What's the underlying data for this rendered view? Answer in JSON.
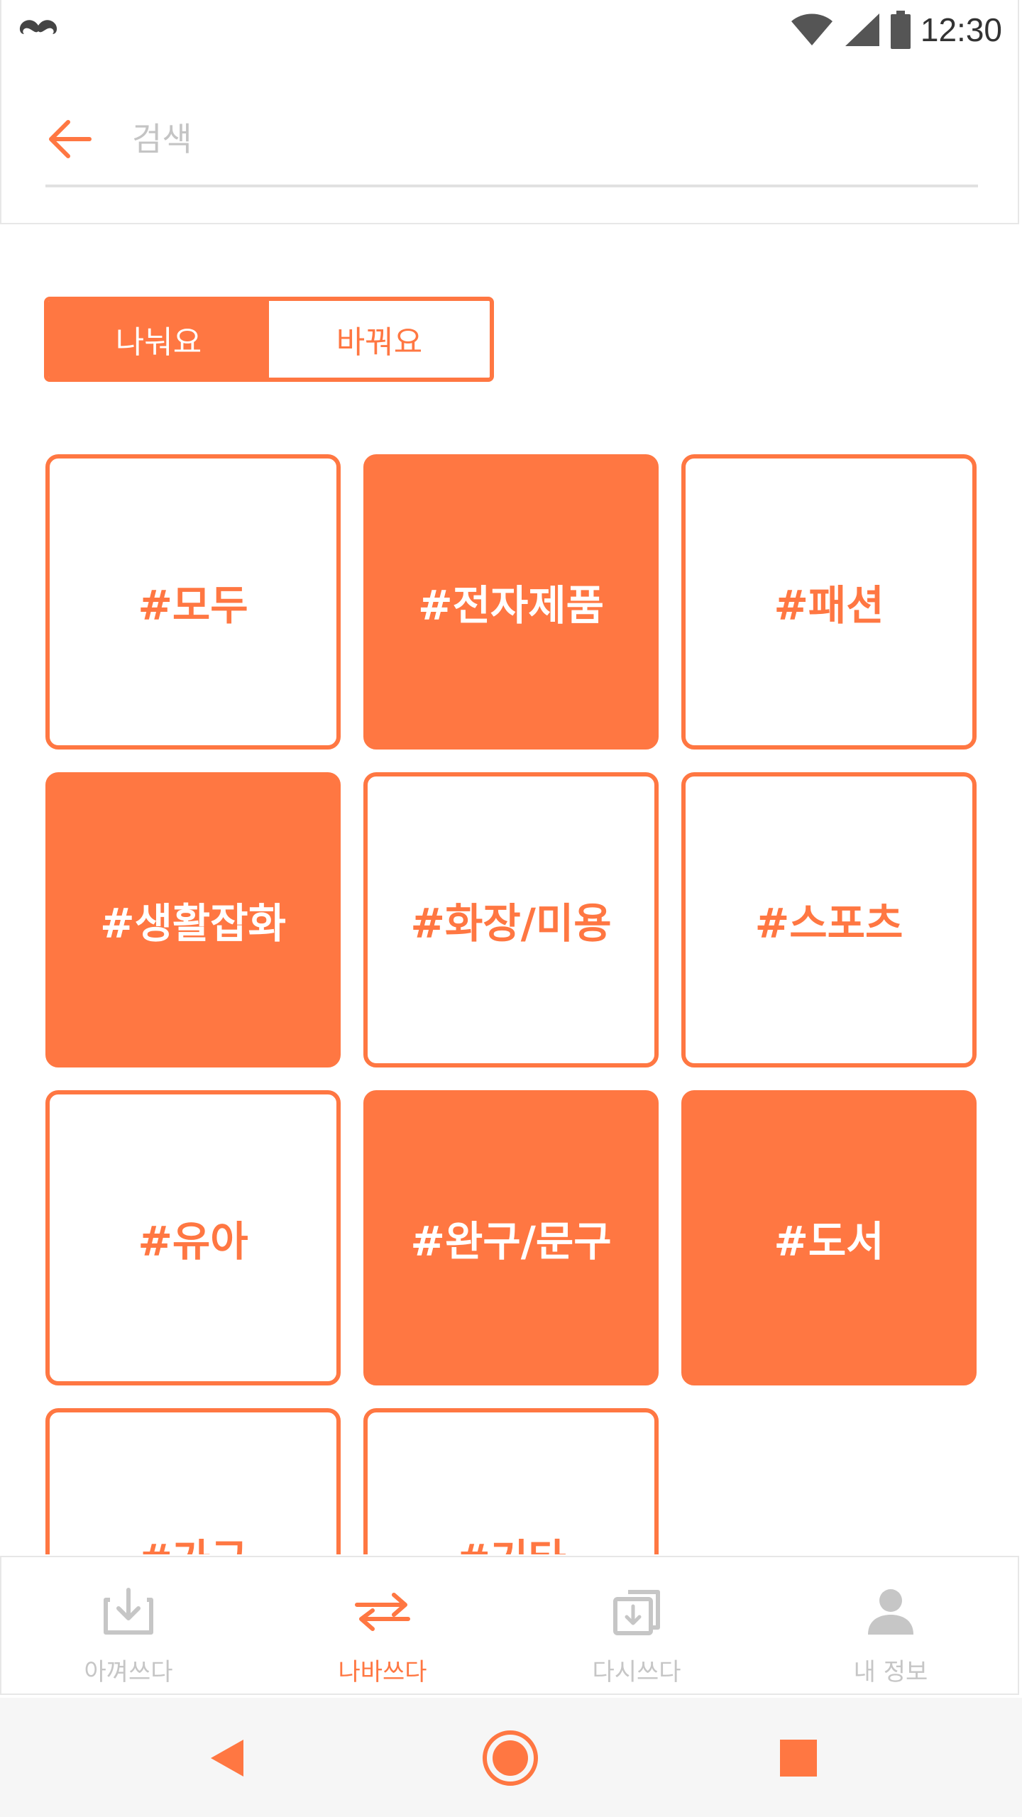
{
  "status_bar": {
    "time": "12:30",
    "icons": [
      "mustache-logo-icon",
      "wifi-icon",
      "signal-icon",
      "battery-icon"
    ]
  },
  "search": {
    "placeholder": "검색",
    "value": ""
  },
  "toggle": {
    "options": [
      {
        "label": "나눠요",
        "selected": true
      },
      {
        "label": "바꿔요",
        "selected": false
      }
    ]
  },
  "categories": [
    {
      "label": "#모두",
      "style": "outline"
    },
    {
      "label": "#전자제품",
      "style": "filled"
    },
    {
      "label": "#패션",
      "style": "outline"
    },
    {
      "label": "#생활잡화",
      "style": "filled"
    },
    {
      "label": "#화장/미용",
      "style": "outline"
    },
    {
      "label": "#스포츠",
      "style": "outline"
    },
    {
      "label": "#유아",
      "style": "outline"
    },
    {
      "label": "#완구/문구",
      "style": "filled"
    },
    {
      "label": "#도서",
      "style": "filled"
    },
    {
      "label": "#가구",
      "style": "outline"
    },
    {
      "label": "#기타",
      "style": "outline"
    }
  ],
  "tabs": [
    {
      "label": "아껴쓰다",
      "icon": "download-tray-icon",
      "active": false
    },
    {
      "label": "나바쓰다",
      "icon": "swap-arrows-icon",
      "active": true
    },
    {
      "label": "다시쓰다",
      "icon": "reuse-box-icon",
      "active": false
    },
    {
      "label": "내 정보",
      "icon": "person-icon",
      "active": false
    }
  ],
  "nav": [
    "back-triangle-icon",
    "home-circle-icon",
    "recents-square-icon"
  ],
  "colors": {
    "accent": "#ff7742",
    "inactive": "#c6c6c6"
  }
}
